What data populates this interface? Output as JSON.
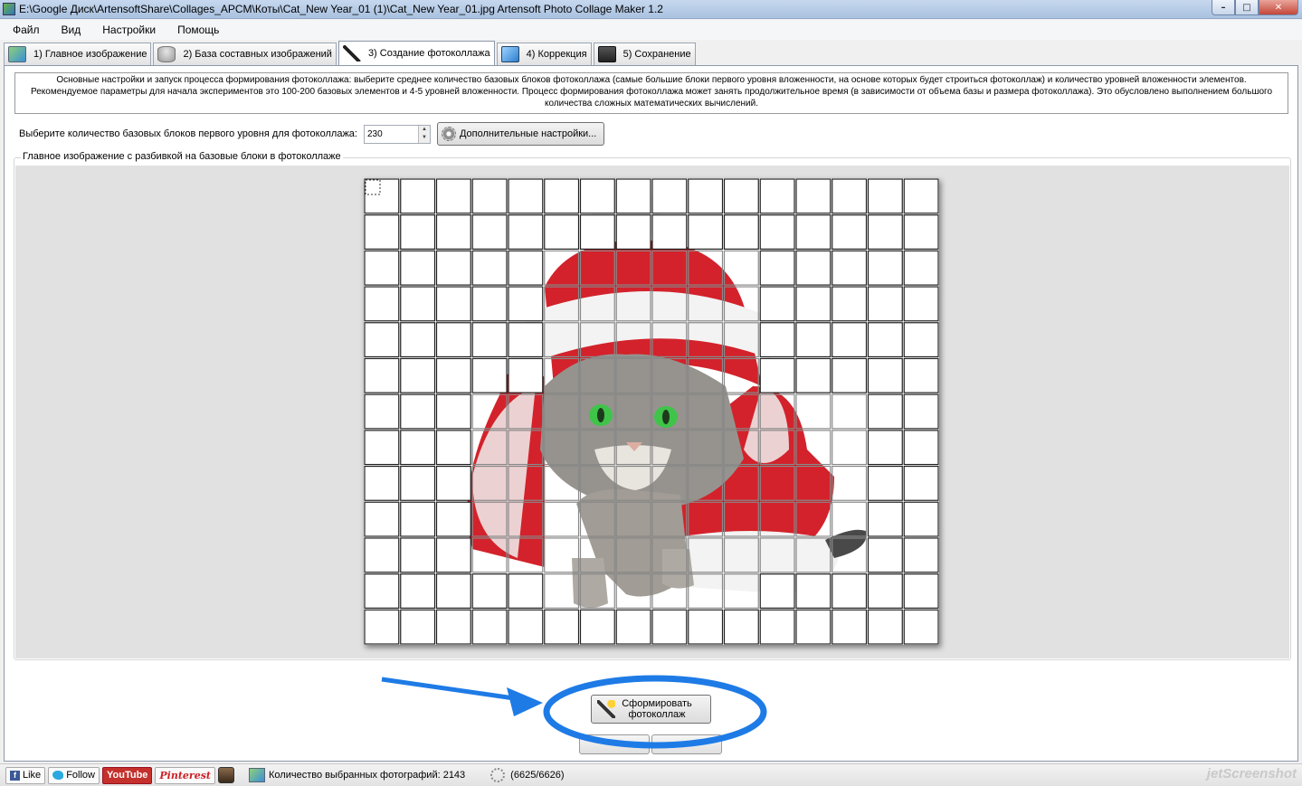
{
  "window": {
    "title": "E:\\Google Диск\\ArtensoftShare\\Collages_APCM\\Коты\\Cat_New Year_01 (1)\\Cat_New Year_01.jpg Artensoft Photo Collage Maker 1.2"
  },
  "menu": [
    "Файл",
    "Вид",
    "Настройки",
    "Помощь"
  ],
  "tabs": [
    {
      "label": "1) Главное изображение",
      "icon": "image-icon"
    },
    {
      "label": "2) База составных изображений",
      "icon": "database-add-icon"
    },
    {
      "label": "3) Создание фотоколлажа",
      "icon": "magic-wand-icon"
    },
    {
      "label": "4) Коррекция",
      "icon": "cube-icon"
    },
    {
      "label": "5) Сохранение",
      "icon": "floppy-disk-icon"
    }
  ],
  "active_tab": 2,
  "info": {
    "text": "Основные настройки и запуск процесса формирования фотоколлажа: выберите среднее количество базовых блоков фотоколлажа (самые большие блоки первого уровня вложенности, на основе которых будет строиться фотоколлаж) и количество уровней вложенности элементов. Рекомендуемое параметры для начала экспериментов это 100-200 базовых элементов и 4-5 уровней вложенности.  Процесс формирования фотоколлажа может занять продолжительное время (в зависимости от объема базы и размера фотоколлажа). Это обусловлено выполнением большого количества сложных математических вычислений."
  },
  "blocks": {
    "label": "Выберите количество базовых блоков первого уровня для фотоколлажа:",
    "value": "230",
    "advanced_button": "Дополнительные настройки..."
  },
  "preview": {
    "group_label": "Главное изображение с разбивкой на базовые блоки в фотоколлаже",
    "grid_columns": 16,
    "grid_rows": 13
  },
  "actions": {
    "form_collage": "Сформировать\nфотоколлаж"
  },
  "status": {
    "like": "Like",
    "follow": "Follow",
    "youtube": "YouTube",
    "pinterest": "Pinterest",
    "selected_photos": "Количество выбранных фотографий: 2143",
    "progress": "(6625/6626)",
    "watermark": "jetScreenshot"
  },
  "colors": {
    "highlight_blue": "#1e7be6",
    "santa_red": "#d0101a",
    "cat_eye": "#2fbf3a"
  }
}
